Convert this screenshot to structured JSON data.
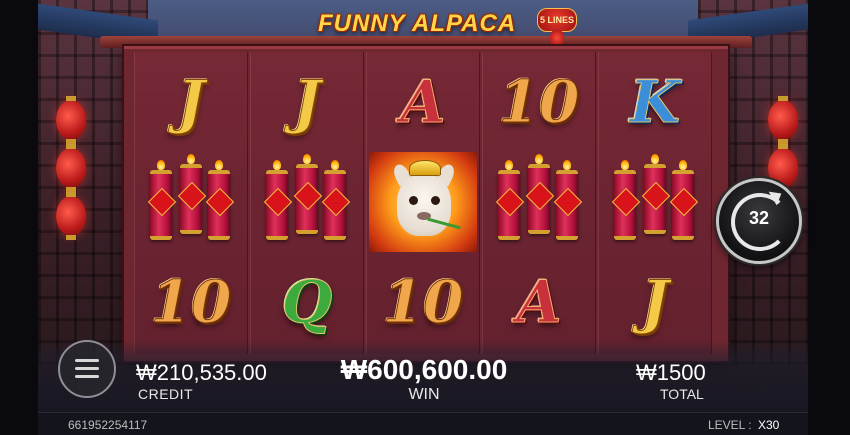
{
  "game": {
    "title": "FUNNY ALPACA",
    "lines_badge": "5 LINES"
  },
  "reels": [
    {
      "top": "J",
      "middle": "firecrackers",
      "bottom": "10"
    },
    {
      "top": "J",
      "middle": "firecrackers",
      "bottom": "Q"
    },
    {
      "top": "A",
      "middle": "alpaca-wild",
      "bottom": "10"
    },
    {
      "top": "10",
      "middle": "firecrackers",
      "bottom": "A"
    },
    {
      "top": "K",
      "middle": "firecrackers",
      "bottom": "J"
    }
  ],
  "spin": {
    "count": "32"
  },
  "credit": {
    "amount": "₩210,535.00",
    "label": "CREDIT"
  },
  "win": {
    "amount": "₩600,600.00",
    "label": "WIN"
  },
  "total": {
    "amount": "₩1500",
    "label": "TOTAL"
  },
  "status": {
    "round_id": "661952254117",
    "level_label": "LEVEL :",
    "level_value": "X30"
  },
  "colors": {
    "reel_bg": "#6e2630",
    "gold_letter": "#f5c948",
    "blue_letter": "#3b8fd8",
    "green_letter": "#3caa3c",
    "red_letter": "#c8303c"
  }
}
